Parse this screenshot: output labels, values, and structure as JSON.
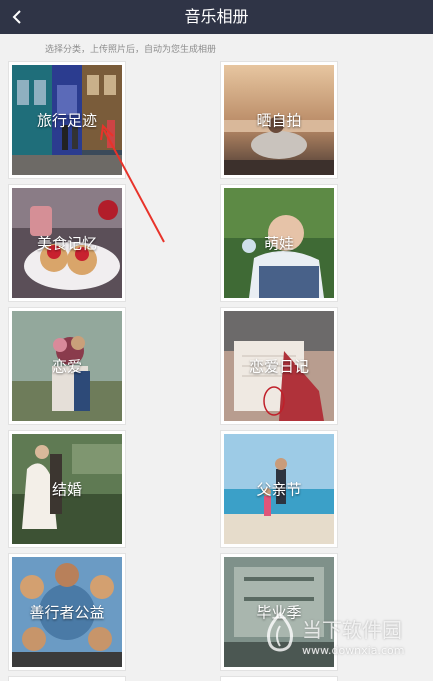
{
  "header": {
    "title": "音乐相册",
    "back_icon": "chevron-left-icon",
    "background": "#2f3446"
  },
  "hint": "选择分类，上传照片后，自动为您生成相册",
  "categories": [
    {
      "label": "旅行足迹"
    },
    {
      "label": "晒自拍"
    },
    {
      "label": "美食记忆"
    },
    {
      "label": "萌娃"
    },
    {
      "label": "恋爱"
    },
    {
      "label": "恋爱日记"
    },
    {
      "label": "结婚"
    },
    {
      "label": "父亲节"
    },
    {
      "label": "善行者公益"
    },
    {
      "label": "毕业季"
    }
  ],
  "annotation": {
    "color": "#e8332a"
  },
  "watermark": {
    "text": "当下软件园",
    "url": "www.downxia.com"
  }
}
